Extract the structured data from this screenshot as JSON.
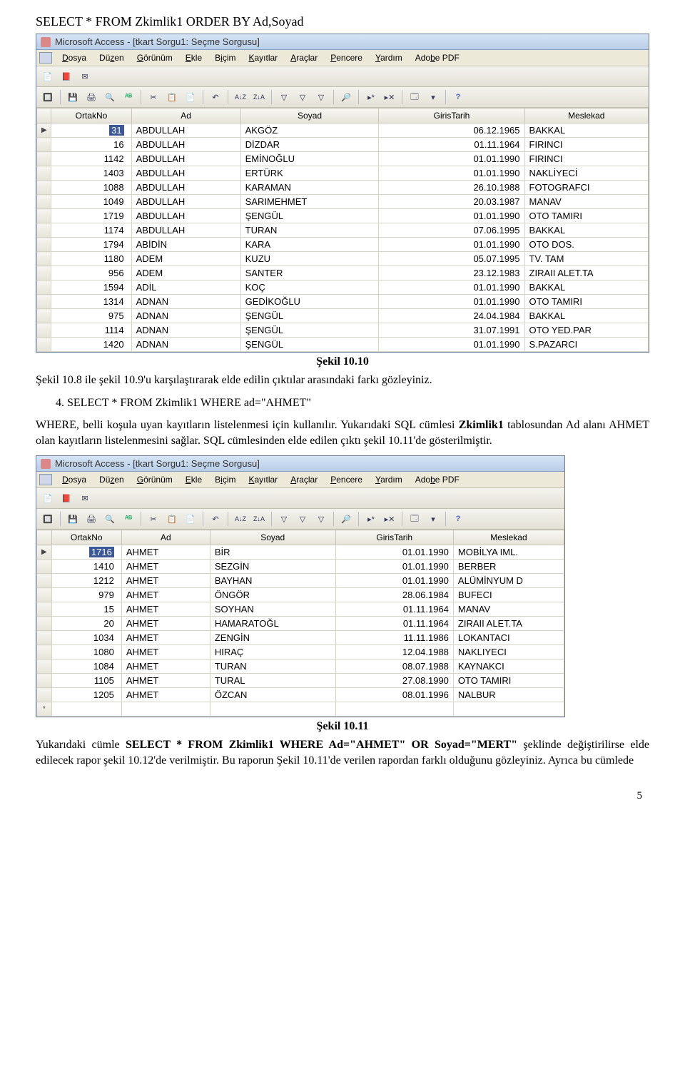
{
  "sql1": "SELECT * FROM Zkimlik1 ORDER BY Ad,Soyad",
  "window_title": "Microsoft Access - [tkart Sorgu1: Seçme Sorgusu]",
  "menus": [
    "Dosya",
    "Düzen",
    "Görünüm",
    "Ekle",
    "Biçim",
    "Kayıtlar",
    "Araçlar",
    "Pencere",
    "Yardım",
    "Adobe PDF"
  ],
  "columns": [
    "OrtakNo",
    "Ad",
    "Soyad",
    "GirisTarih",
    "Meslekad"
  ],
  "grid1_rows": [
    {
      "no": "31",
      "ad": "ABDULLAH",
      "soy": "AKGÖZ",
      "tar": "06.12.1965",
      "mes": "BAKKAL",
      "sel": true,
      "first": true
    },
    {
      "no": "16",
      "ad": "ABDULLAH",
      "soy": "DİZDAR",
      "tar": "01.11.1964",
      "mes": "FIRINCI"
    },
    {
      "no": "1142",
      "ad": "ABDULLAH",
      "soy": "EMİNOĞLU",
      "tar": "01.01.1990",
      "mes": "FIRINCI"
    },
    {
      "no": "1403",
      "ad": "ABDULLAH",
      "soy": "ERTÜRK",
      "tar": "01.01.1990",
      "mes": "NAKLİYECİ"
    },
    {
      "no": "1088",
      "ad": "ABDULLAH",
      "soy": "KARAMAN",
      "tar": "26.10.1988",
      "mes": "FOTOGRAFCI"
    },
    {
      "no": "1049",
      "ad": "ABDULLAH",
      "soy": "SARIMEHMET",
      "tar": "20.03.1987",
      "mes": "MANAV"
    },
    {
      "no": "1719",
      "ad": "ABDULLAH",
      "soy": "ŞENGÜL",
      "tar": "01.01.1990",
      "mes": "OTO TAMIRI"
    },
    {
      "no": "1174",
      "ad": "ABDULLAH",
      "soy": "TURAN",
      "tar": "07.06.1995",
      "mes": "BAKKAL"
    },
    {
      "no": "1794",
      "ad": "ABİDİN",
      "soy": "KARA",
      "tar": "01.01.1990",
      "mes": "OTO DOS."
    },
    {
      "no": "1180",
      "ad": "ADEM",
      "soy": "KUZU",
      "tar": "05.07.1995",
      "mes": "TV. TAM"
    },
    {
      "no": "956",
      "ad": "ADEM",
      "soy": "SANTER",
      "tar": "23.12.1983",
      "mes": "ZIRAII ALET.TA"
    },
    {
      "no": "1594",
      "ad": "ADİL",
      "soy": "KOÇ",
      "tar": "01.01.1990",
      "mes": "BAKKAL"
    },
    {
      "no": "1314",
      "ad": "ADNAN",
      "soy": "GEDİKOĞLU",
      "tar": "01.01.1990",
      "mes": "OTO TAMIRI"
    },
    {
      "no": "975",
      "ad": "ADNAN",
      "soy": "ŞENGÜL",
      "tar": "24.04.1984",
      "mes": "BAKKAL"
    },
    {
      "no": "1114",
      "ad": "ADNAN",
      "soy": "ŞENGÜL",
      "tar": "31.07.1991",
      "mes": "OTO YED.PAR"
    },
    {
      "no": "1420",
      "ad": "ADNAN",
      "soy": "ŞENGÜL",
      "tar": "01.01.1990",
      "mes": "S.PAZARCI"
    }
  ],
  "caption1": "Şekil 10.10",
  "para1": "Şekil 10.8 ile şekil 10.9'u karşılaştırarak elde edilin çıktılar arasındaki farkı gözleyiniz.",
  "item4_heading": "4. SELECT * FROM Zkimlik1 WHERE ad=\"AHMET\"",
  "para2_a": "WHERE, belli koşula uyan kayıtların listelenmesi için kullanılır. Yukarıdaki SQL cümlesi ",
  "para2_b_bold": "Zkimlik1",
  "para2_c": " tablosundan Ad alanı AHMET olan kayıtların listelenmesini sağlar. SQL cümlesinden elde edilen çıktı şekil 10.11'de gösterilmiştir.",
  "grid2_rows": [
    {
      "no": "1716",
      "ad": "AHMET",
      "soy": "BİR",
      "tar": "01.01.1990",
      "mes": "MOBİLYA IML.",
      "sel": true,
      "first": true
    },
    {
      "no": "1410",
      "ad": "AHMET",
      "soy": "SEZGİN",
      "tar": "01.01.1990",
      "mes": "BERBER"
    },
    {
      "no": "1212",
      "ad": "AHMET",
      "soy": "BAYHAN",
      "tar": "01.01.1990",
      "mes": "ALÜMİNYUM D"
    },
    {
      "no": "979",
      "ad": "AHMET",
      "soy": "ÖNGÖR",
      "tar": "28.06.1984",
      "mes": "BUFECI"
    },
    {
      "no": "15",
      "ad": "AHMET",
      "soy": "SOYHAN",
      "tar": "01.11.1964",
      "mes": "MANAV"
    },
    {
      "no": "20",
      "ad": "AHMET",
      "soy": "HAMARATOĞL",
      "tar": "01.11.1964",
      "mes": "ZIRAII ALET.TA"
    },
    {
      "no": "1034",
      "ad": "AHMET",
      "soy": "ZENGİN",
      "tar": "11.11.1986",
      "mes": "LOKANTACI"
    },
    {
      "no": "1080",
      "ad": "AHMET",
      "soy": "HIRAÇ",
      "tar": "12.04.1988",
      "mes": "NAKLIYECI"
    },
    {
      "no": "1084",
      "ad": "AHMET",
      "soy": "TURAN",
      "tar": "08.07.1988",
      "mes": "KAYNAKCI"
    },
    {
      "no": "1105",
      "ad": "AHMET",
      "soy": "TURAL",
      "tar": "27.08.1990",
      "mes": "OTO TAMIRI"
    },
    {
      "no": "1205",
      "ad": "AHMET",
      "soy": "ÖZCAN",
      "tar": "08.01.1996",
      "mes": "NALBUR"
    }
  ],
  "caption2": "Şekil 10.11",
  "para3_a": "Yukarıdaki cümle ",
  "para3_b_bold": "SELECT * FROM Zkimlik1 WHERE Ad=\"AHMET\" OR Soyad=\"MERT\"",
  "para3_c": " şeklinde değiştirilirse elde edilecek rapor şekil 10.12'de verilmiştir. Bu raporun Şekil 10.11'de verilen rapordan farklı olduğunu gözleyiniz.  Ayrıca bu cümlede",
  "page_number": "5"
}
